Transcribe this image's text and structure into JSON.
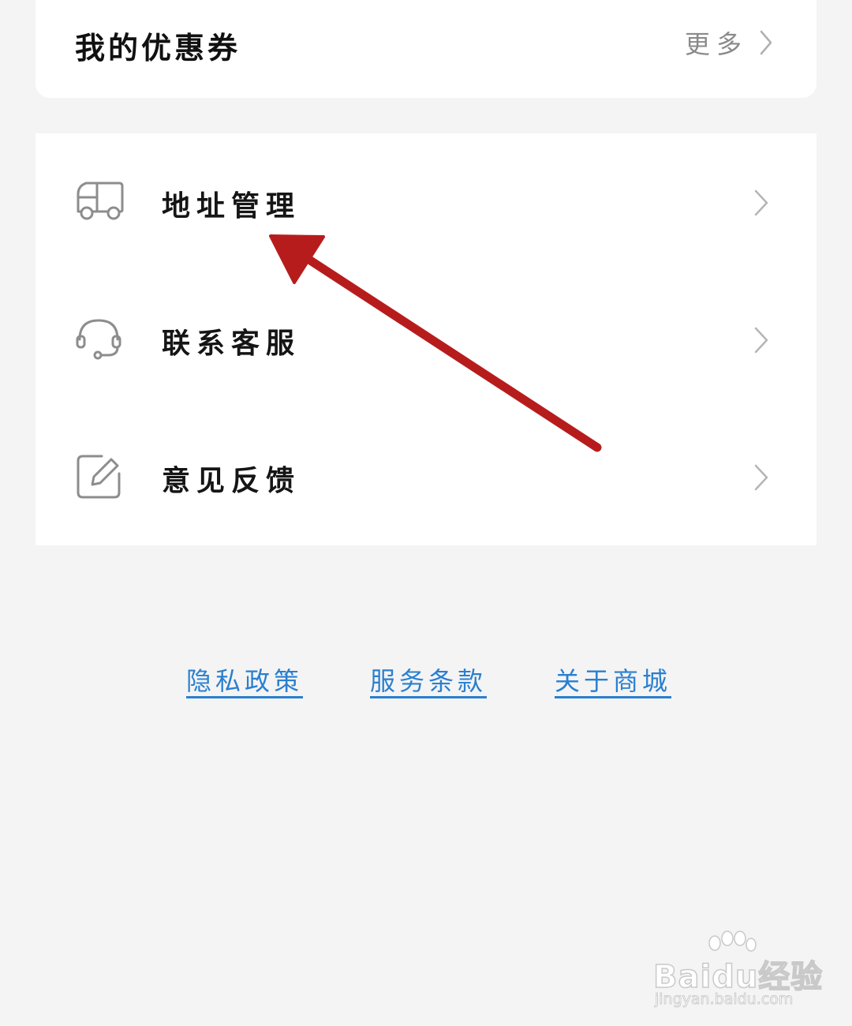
{
  "coupons": {
    "title": "我的优惠券",
    "more_label": "更多"
  },
  "menu": {
    "items": [
      {
        "label": "地址管理",
        "icon": "truck-icon"
      },
      {
        "label": "联系客服",
        "icon": "headset-icon"
      },
      {
        "label": "意见反馈",
        "icon": "edit-icon"
      }
    ]
  },
  "footer": {
    "links": [
      "隐私政策",
      "服务条款",
      "关于商城"
    ]
  },
  "watermark": {
    "logo": "Baidu经验",
    "url": "jingyan.baidu.com"
  },
  "colors": {
    "background": "#f4f4f4",
    "card": "#ffffff",
    "link": "#2a7fd0",
    "annotation_arrow": "#b71c1c"
  }
}
